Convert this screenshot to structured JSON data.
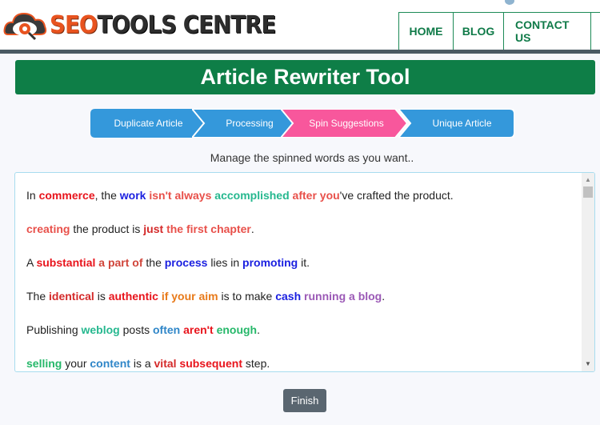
{
  "header": {
    "logo": {
      "part1": "SEO",
      "part2": "TOOLS CENTRE"
    },
    "nav": [
      {
        "label": "HOME"
      },
      {
        "label": "BLOG"
      },
      {
        "label": "CONTACT US"
      }
    ]
  },
  "title": "Article Rewriter Tool",
  "steps": [
    {
      "label": "Duplicate Article",
      "color": "#3498db"
    },
    {
      "label": "Processing",
      "color": "#3498db"
    },
    {
      "label": "Spin Suggestions",
      "color": "#f8579c",
      "active": true
    },
    {
      "label": "Unique Article",
      "color": "#3498db"
    }
  ],
  "subtitle": "Manage the spinned words as you want..",
  "paragraphs": [
    [
      {
        "t": "In "
      },
      {
        "t": "commerce",
        "c": "#e8141c"
      },
      {
        "t": ", the "
      },
      {
        "t": "work",
        "c": "#1a1fe0"
      },
      {
        "t": " "
      },
      {
        "t": "isn't always",
        "c": "#e8504a"
      },
      {
        "t": " "
      },
      {
        "t": "accomplished",
        "c": "#26b88f"
      },
      {
        "t": " "
      },
      {
        "t": "after you",
        "c": "#e8504a"
      },
      {
        "t": "'ve crafted the product."
      }
    ],
    [
      {
        "t": "creating",
        "c": "#e8504a"
      },
      {
        "t": " the product is "
      },
      {
        "t": "just",
        "c": "#d42a2a"
      },
      {
        "t": " "
      },
      {
        "t": "the first chapter",
        "c": "#e8504a"
      },
      {
        "t": "."
      }
    ],
    [
      {
        "t": "A "
      },
      {
        "t": "substantial",
        "c": "#e8141c"
      },
      {
        "t": " "
      },
      {
        "t": "a part of",
        "c": "#d0453a"
      },
      {
        "t": " the "
      },
      {
        "t": "process",
        "c": "#1a1fe0"
      },
      {
        "t": " lies in "
      },
      {
        "t": "promoting",
        "c": "#1a1fe0"
      },
      {
        "t": " it."
      }
    ],
    [
      {
        "t": "The "
      },
      {
        "t": "identical",
        "c": "#d42a2a"
      },
      {
        "t": " is "
      },
      {
        "t": "authentic",
        "c": "#e8141c"
      },
      {
        "t": " "
      },
      {
        "t": "if your aim",
        "c": "#e87a1a"
      },
      {
        "t": " is to make "
      },
      {
        "t": "cash",
        "c": "#1a1fe0"
      },
      {
        "t": " "
      },
      {
        "t": "running a blog",
        "c": "#9b59b6"
      },
      {
        "t": "."
      }
    ],
    [
      {
        "t": "Publishing "
      },
      {
        "t": "weblog",
        "c": "#26b88f"
      },
      {
        "t": " posts "
      },
      {
        "t": "often",
        "c": "#2f86c8"
      },
      {
        "t": " "
      },
      {
        "t": "aren't",
        "c": "#e8141c"
      },
      {
        "t": " "
      },
      {
        "t": "enough",
        "c": "#26b86a"
      },
      {
        "t": "."
      }
    ],
    [
      {
        "t": "selling",
        "c": "#26b86a"
      },
      {
        "t": " your "
      },
      {
        "t": "content",
        "c": "#2f86c8"
      },
      {
        "t": " is a "
      },
      {
        "t": "vital",
        "c": "#d42a2a"
      },
      {
        "t": " "
      },
      {
        "t": "subsequent",
        "c": "#e8141c"
      },
      {
        "t": " step."
      }
    ]
  ],
  "finish_label": "Finish"
}
